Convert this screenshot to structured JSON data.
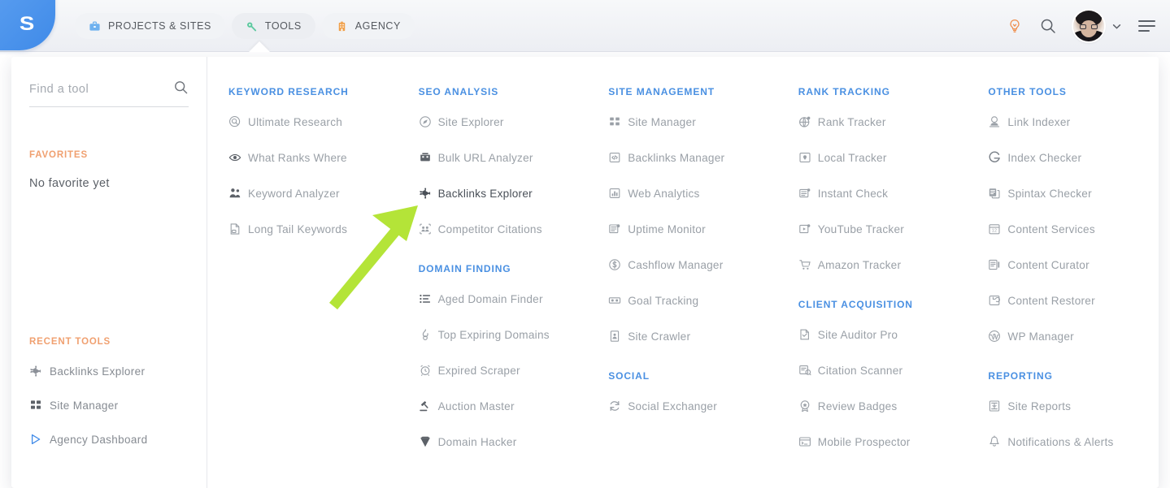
{
  "header": {
    "logo_text": "S",
    "tabs": [
      {
        "label": "PROJECTS & SITES",
        "icon": "briefcase-icon",
        "color": "#6eb1ef"
      },
      {
        "label": "TOOLS",
        "icon": "wrench-icon",
        "color": "#5ec9a0"
      },
      {
        "label": "AGENCY",
        "icon": "building-icon",
        "color": "#f0a04b"
      }
    ],
    "actions": [
      {
        "name": "lightbulb-icon",
        "color": "#ef8f4e"
      },
      {
        "name": "search-icon",
        "color": "#5b6068"
      },
      {
        "name": "avatar",
        "color": "#d3b49f"
      },
      {
        "name": "chevron-down-icon",
        "color": "#5b6068"
      },
      {
        "name": "hamburger-menu-icon",
        "color": "#5b6068"
      }
    ]
  },
  "sidebar": {
    "search_placeholder": "Find a tool",
    "search_value": "",
    "favorites_heading": "FAVORITES",
    "favorites_empty": "No favorite yet",
    "recent_heading": "RECENT TOOLS",
    "recent_items": [
      {
        "label": "Backlinks Explorer",
        "icon": "backlinks-explorer-icon"
      },
      {
        "label": "Site Manager",
        "icon": "grid-squares-icon"
      },
      {
        "label": "Agency Dashboard",
        "icon": "play-triangle-icon"
      }
    ]
  },
  "columns": [
    {
      "groups": [
        {
          "title": "KEYWORD RESEARCH",
          "tools": [
            {
              "label": "Ultimate Research",
              "icon": "magnifier-circle-icon"
            },
            {
              "label": "What Ranks Where",
              "icon": "eye-icon"
            },
            {
              "label": "Keyword Analyzer",
              "icon": "people-icon"
            },
            {
              "label": "Long Tail Keywords",
              "icon": "document-text-icon"
            }
          ]
        }
      ]
    },
    {
      "groups": [
        {
          "title": "SEO ANALYSIS",
          "tools": [
            {
              "label": "Site Explorer",
              "icon": "compass-icon"
            },
            {
              "label": "Bulk URL Analyzer",
              "icon": "bulk-url-icon"
            },
            {
              "label": "Backlinks Explorer",
              "icon": "backlinks-explorer-icon",
              "highlight": true
            },
            {
              "label": "Competitor Citations",
              "icon": "competitor-citations-icon"
            }
          ]
        },
        {
          "title": "DOMAIN FINDING",
          "tools": [
            {
              "label": "Aged Domain Finder",
              "icon": "list-icon"
            },
            {
              "label": "Top Expiring Domains",
              "icon": "flame-icon"
            },
            {
              "label": "Expired Scraper",
              "icon": "alarm-clock-icon"
            },
            {
              "label": "Auction Master",
              "icon": "gavel-icon"
            },
            {
              "label": "Domain Hacker",
              "icon": "diamond-icon"
            }
          ]
        }
      ]
    },
    {
      "groups": [
        {
          "title": "SITE MANAGEMENT",
          "tools": [
            {
              "label": "Site Manager",
              "icon": "grid-squares-icon"
            },
            {
              "label": "Backlinks Manager",
              "icon": "code-box-icon"
            },
            {
              "label": "Web Analytics",
              "icon": "bar-chart-icon"
            },
            {
              "label": "Uptime Monitor",
              "icon": "uptime-doc-icon"
            },
            {
              "label": "Cashflow Manager",
              "icon": "dollar-circle-icon"
            },
            {
              "label": "Goal Tracking",
              "icon": "goal-box-icon"
            },
            {
              "label": "Site Crawler",
              "icon": "crawler-icon"
            }
          ]
        },
        {
          "title": "SOCIAL",
          "tools": [
            {
              "label": "Social Exchanger",
              "icon": "refresh-circle-icon"
            }
          ]
        }
      ]
    },
    {
      "groups": [
        {
          "title": "RANK TRACKING",
          "tools": [
            {
              "label": "Rank Tracker",
              "icon": "globe-rank-icon"
            },
            {
              "label": "Local Tracker",
              "icon": "local-map-icon"
            },
            {
              "label": "Instant Check",
              "icon": "instant-check-icon"
            },
            {
              "label": "YouTube Tracker",
              "icon": "youtube-box-icon"
            },
            {
              "label": "Amazon Tracker",
              "icon": "cart-icon"
            }
          ]
        },
        {
          "title": "CLIENT ACQUISITION",
          "tools": [
            {
              "label": "Site Auditor Pro",
              "icon": "audit-page-icon"
            },
            {
              "label": "Citation Scanner",
              "icon": "citation-scan-icon"
            },
            {
              "label": "Review Badges",
              "icon": "badge-icon"
            },
            {
              "label": "Mobile Prospector",
              "icon": "browser-terminal-icon"
            }
          ]
        }
      ]
    },
    {
      "groups": [
        {
          "title": "OTHER TOOLS",
          "tools": [
            {
              "label": "Link Indexer",
              "icon": "link-indexer-icon"
            },
            {
              "label": "Index Checker",
              "icon": "google-g-icon"
            },
            {
              "label": "Spintax Checker",
              "icon": "copy-pages-icon"
            },
            {
              "label": "Content Services",
              "icon": "calendar-12-icon"
            },
            {
              "label": "Content Curator",
              "icon": "content-list-icon"
            },
            {
              "label": "Content Restorer",
              "icon": "restore-box-icon"
            },
            {
              "label": "WP Manager",
              "icon": "wordpress-icon"
            }
          ]
        },
        {
          "title": "REPORTING",
          "tools": [
            {
              "label": "Site Reports",
              "icon": "report-icon"
            },
            {
              "label": "Notifications & Alerts",
              "icon": "bell-icon"
            }
          ]
        }
      ]
    }
  ],
  "annotation": {
    "type": "arrow",
    "color": "#b4e438",
    "points_to": "Backlinks Explorer"
  }
}
